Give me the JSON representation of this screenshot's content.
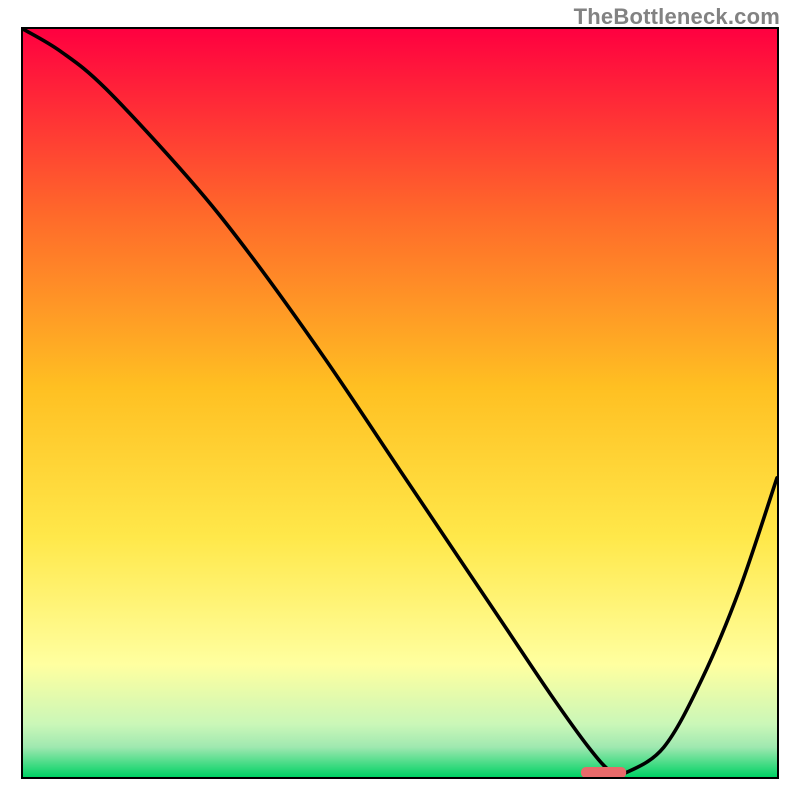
{
  "attribution": "TheBottleneck.com",
  "colors": {
    "border": "#000000",
    "curve": "#000000",
    "gradient_top": "#ff0040",
    "gradient_mid_upper": "#ff6a2a",
    "gradient_mid": "#ffc022",
    "gradient_mid_lower": "#ffe84a",
    "gradient_low": "#ffffa0",
    "gradient_green_start": "#caf7b8",
    "gradient_green": "#00d264",
    "marker_fill": "#e86a6a"
  },
  "chart_data": {
    "type": "line",
    "title": "",
    "xlabel": "",
    "ylabel": "",
    "xlim": [
      0,
      100
    ],
    "ylim": [
      0,
      100
    ],
    "x": [
      0,
      5,
      11,
      22,
      30,
      40,
      50,
      58,
      64,
      70,
      75,
      78,
      80,
      85,
      90,
      95,
      100
    ],
    "values": [
      100,
      97,
      92,
      80,
      70,
      56,
      41,
      29,
      20,
      11,
      4,
      0.7,
      0.6,
      4,
      13,
      25,
      40
    ],
    "marker": {
      "x_start": 74,
      "x_end": 80,
      "y": 0.6
    },
    "notes": "Values read off the plotted curve relative to the framed area; y = 100 is frame top, y = 0 is frame bottom. Curve starts at top-left, descends to a minimum near x≈77–80 (marked by a short rounded red segment), then rises toward the right edge reaching roughly 40% height."
  }
}
